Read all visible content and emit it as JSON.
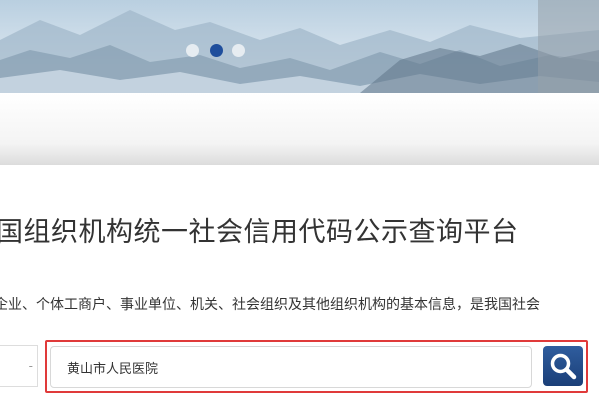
{
  "banner": {
    "carousel_dots": [
      {
        "active": false
      },
      {
        "active": true
      },
      {
        "active": false
      }
    ],
    "active_dot_color": "#1f4e9c"
  },
  "main": {
    "title": "国组织机构统一社会信用代码公示查询平台",
    "description": "企业、个体工商户、事业单位、机关、社会组织及其他组织机构的基本信息，是我国社会",
    "left_box_text": "-"
  },
  "search": {
    "value": "黄山市人民医院",
    "button_icon": "search-icon",
    "button_color": "#1f4e9c",
    "highlight_color": "#e03a3a"
  }
}
